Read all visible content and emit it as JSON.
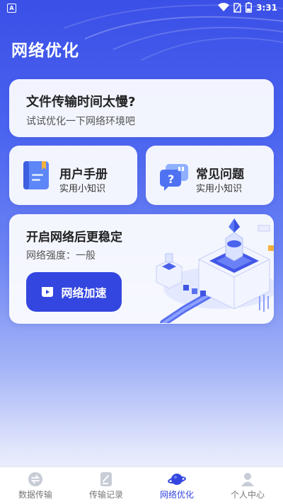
{
  "status_bar": {
    "time": "3:31",
    "left_icon_letter": "A"
  },
  "header": {
    "title": "网络优化"
  },
  "slow_card": {
    "title": "文件传输时间太慢?",
    "subtitle": "试试优化一下网络环境吧"
  },
  "manual_card": {
    "title": "用户手册",
    "subtitle": "实用小知识",
    "icon": "manual-book-icon"
  },
  "faq_card": {
    "title": "常见问题",
    "subtitle": "实用小知识",
    "icon": "question-chat-icon"
  },
  "boost_card": {
    "title": "开启网络后更稳定",
    "strength": "网络强度：一般",
    "button_label": "网络加速",
    "button_icon": "video-play-icon"
  },
  "tabbar": {
    "active_index": 2,
    "items": [
      {
        "label": "数据传输",
        "icon": "transfer-icon"
      },
      {
        "label": "传输记录",
        "icon": "record-icon"
      },
      {
        "label": "网络优化",
        "icon": "planet-icon"
      },
      {
        "label": "个人中心",
        "icon": "user-icon"
      }
    ]
  },
  "colors": {
    "accent": "#3446e0",
    "header_bg": "#3a4fe6",
    "card_bg": "#ffffff"
  }
}
